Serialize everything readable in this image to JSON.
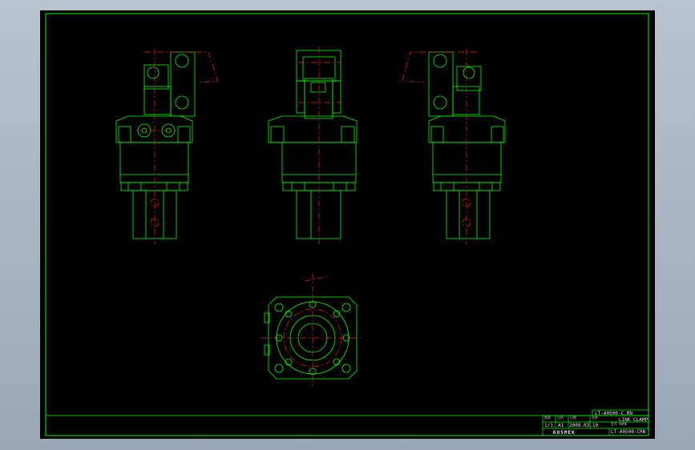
{
  "viewer": {
    "background_color": "#a6b1bf"
  },
  "drawing": {
    "line_color": "#00ff00",
    "centerline_color": "#ff2020",
    "title_block": {
      "part_number_top": "LT-A0500-C.RN",
      "header_labels": [
        "数量",
        "比例",
        "日期",
        "名称"
      ],
      "quantity": "1/1",
      "scale": "A1",
      "date": "2009.03.10",
      "name": "LINK CLAMP",
      "part_number_label": "型号 NAME",
      "part_number": "LT-A0500-CRN",
      "company": "KOSMEK"
    }
  }
}
